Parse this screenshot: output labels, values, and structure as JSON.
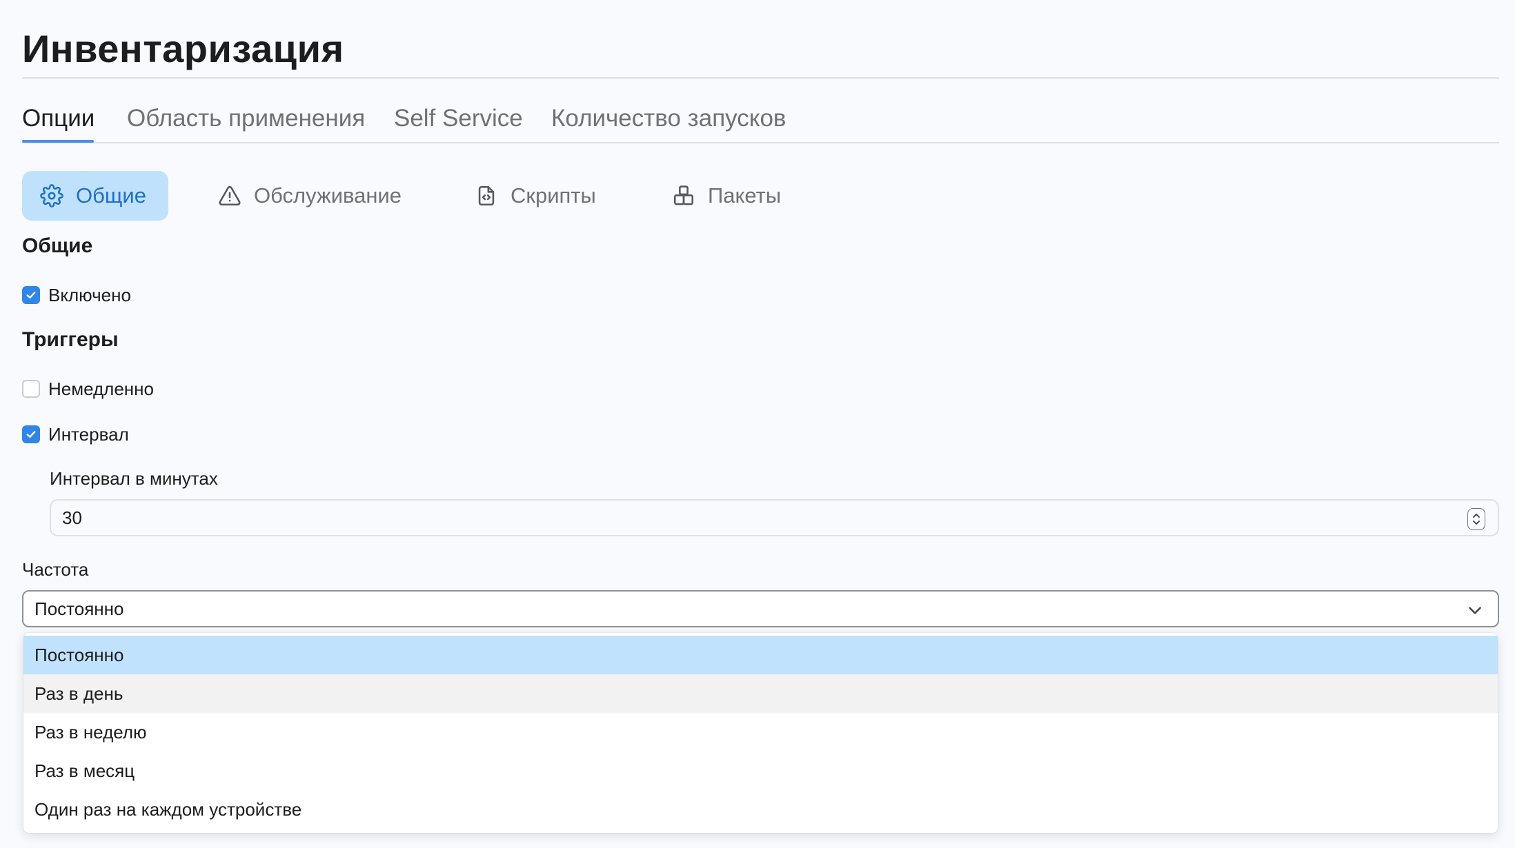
{
  "page": {
    "title": "Инвентаризация"
  },
  "tabs": [
    {
      "label": "Опции",
      "active": true
    },
    {
      "label": "Область применения",
      "active": false
    },
    {
      "label": "Self Service",
      "active": false
    },
    {
      "label": "Количество запусков",
      "active": false
    }
  ],
  "subtabs": [
    {
      "label": "Общие",
      "icon": "gear-icon",
      "active": true
    },
    {
      "label": "Обслуживание",
      "icon": "warning-icon",
      "active": false
    },
    {
      "label": "Скрипты",
      "icon": "script-icon",
      "active": false
    },
    {
      "label": "Пакеты",
      "icon": "package-icon",
      "active": false
    }
  ],
  "general": {
    "title": "Общие",
    "enabled": {
      "label": "Включено",
      "checked": true
    }
  },
  "triggers": {
    "title": "Триггеры",
    "immediately": {
      "label": "Немедленно",
      "checked": false
    },
    "interval": {
      "label": "Интервал",
      "checked": true
    },
    "interval_minutes": {
      "label": "Интервал в минутах",
      "value": "30"
    }
  },
  "frequency": {
    "label": "Частота",
    "selected": "Постоянно",
    "options": [
      "Постоянно",
      "Раз в день",
      "Раз в неделю",
      "Раз в месяц",
      "Один раз на каждом устройстве"
    ],
    "selected_index": 0,
    "hovered_index": 1
  },
  "colors": {
    "accent": "#2f86e6",
    "active_subtab_bg": "#bfe1fc",
    "active_subtab_text": "#1f6fc6",
    "tab_underline": "#4a90e2",
    "selected_option_bg": "#c0e2fc",
    "hovered_option_bg": "#f2f2f2"
  }
}
